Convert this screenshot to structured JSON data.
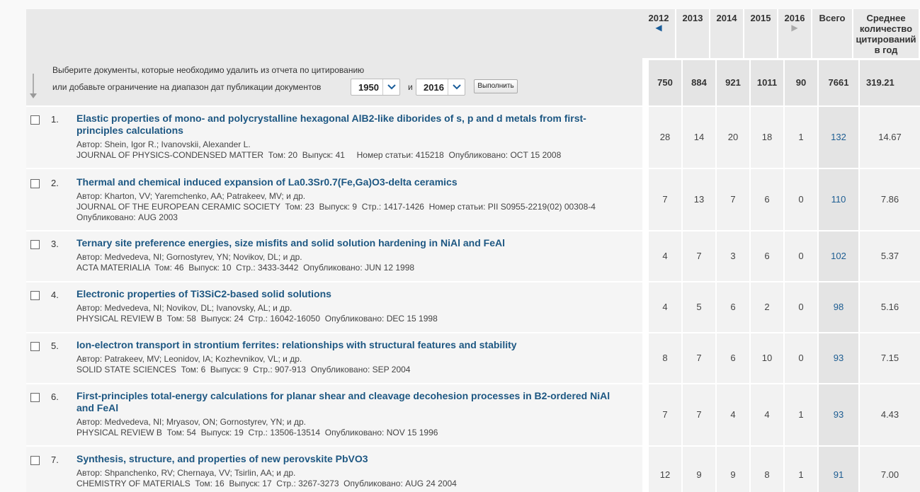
{
  "instruction": {
    "line1": "Выберите документы, которые необходимо удалить из отчета по цитированию",
    "line2": "или добавьте ограничение на диапазон дат публикации документов",
    "and": "и",
    "from_year": "1950",
    "to_year": "2016",
    "apply_button": "Выполнить"
  },
  "columns": {
    "years": [
      "2012",
      "2013",
      "2014",
      "2015",
      "2016"
    ],
    "total": "Всего",
    "average": "Среднее количество цитирований в год"
  },
  "totals": {
    "years": [
      "750",
      "884",
      "921",
      "1011",
      "90"
    ],
    "total": "7661",
    "average": "319.21"
  },
  "records": [
    {
      "num": "1.",
      "title": "Elastic properties of mono- and polycrystalline hexagonal AlB2-like diborides of s, p and d metals from first-principles calculations",
      "authors": "Автор: Shein, Igor R.; Ivanovskii, Alexander L.",
      "source": "JOURNAL OF PHYSICS-CONDENSED MATTER  Том: 20  Выпуск: 41     Номер статьи: 415218  Опубликовано: OCT 15 2008",
      "years": [
        "28",
        "14",
        "20",
        "18",
        "1"
      ],
      "total": "132",
      "average": "14.67"
    },
    {
      "num": "2.",
      "title": "Thermal and chemical induced expansion of La0.3Sr0.7(Fe,Ga)O3-delta ceramics",
      "authors": "Автор: Kharton, VV; Yaremchenko, AA; Patrakeev, MV; и др.",
      "source": "JOURNAL OF THE EUROPEAN CERAMIC SOCIETY  Том: 23  Выпуск: 9  Стр.: 1417-1426  Номер статьи: PII S0955-2219(02) 00308-4  Опубликовано: AUG 2003",
      "years": [
        "7",
        "13",
        "7",
        "6",
        "0"
      ],
      "total": "110",
      "average": "7.86"
    },
    {
      "num": "3.",
      "title": "Ternary site preference energies, size misfits and solid solution hardening in NiAl and FeAl",
      "authors": "Автор: Medvedeva, NI; Gornostyrev, YN; Novikov, DL; и др.",
      "source": "ACTA MATERIALIA  Том: 46  Выпуск: 10  Стр.: 3433-3442  Опубликовано: JUN 12 1998",
      "years": [
        "4",
        "7",
        "3",
        "6",
        "0"
      ],
      "total": "102",
      "average": "5.37"
    },
    {
      "num": "4.",
      "title": "Electronic properties of Ti3SiC2-based solid solutions",
      "authors": "Автор: Medvedeva, NI; Novikov, DL; Ivanovsky, AL; и др.",
      "source": "PHYSICAL REVIEW B  Том: 58  Выпуск: 24  Стр.: 16042-16050  Опубликовано: DEC 15 1998",
      "years": [
        "4",
        "5",
        "6",
        "2",
        "0"
      ],
      "total": "98",
      "average": "5.16"
    },
    {
      "num": "5.",
      "title": "Ion-electron transport in strontium ferrites: relationships with structural features and stability",
      "authors": "Автор: Patrakeev, MV; Leonidov, IA; Kozhevnikov, VL; и др.",
      "source": "SOLID STATE SCIENCES  Том: 6  Выпуск: 9  Стр.: 907-913  Опубликовано: SEP 2004",
      "years": [
        "8",
        "7",
        "6",
        "10",
        "0"
      ],
      "total": "93",
      "average": "7.15"
    },
    {
      "num": "6.",
      "title": "First-principles total-energy calculations for planar shear and cleavage decohesion processes in B2-ordered NiAl and FeAl",
      "authors": "Автор: Medvedeva, NI; Mryasov, ON; Gornostyrev, YN; и др.",
      "source": "PHYSICAL REVIEW B  Том: 54  Выпуск: 19  Стр.: 13506-13514  Опубликовано: NOV 15 1996",
      "years": [
        "7",
        "7",
        "4",
        "4",
        "1"
      ],
      "total": "93",
      "average": "4.43"
    },
    {
      "num": "7.",
      "title": "Synthesis, structure, and properties of new perovskite PbVO3",
      "authors": "Автор: Shpanchenko, RV; Chernaya, VV; Tsirlin, AA; и др.",
      "source": "CHEMISTRY OF MATERIALS  Том: 16  Выпуск: 17  Стр.: 3267-3273  Опубликовано: AUG 24 2004",
      "years": [
        "12",
        "9",
        "9",
        "8",
        "1"
      ],
      "total": "91",
      "average": "7.00"
    }
  ]
}
